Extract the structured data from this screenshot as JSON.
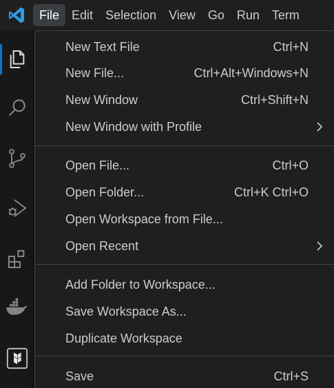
{
  "menubar": {
    "logo_icon": "vscode-logo-icon",
    "items": [
      {
        "label": "File",
        "active": true
      },
      {
        "label": "Edit"
      },
      {
        "label": "Selection"
      },
      {
        "label": "View"
      },
      {
        "label": "Go"
      },
      {
        "label": "Run"
      },
      {
        "label": "Term"
      }
    ]
  },
  "activitybar": {
    "icons": [
      "explorer-icon",
      "search-icon",
      "source-control-icon",
      "run-debug-icon",
      "extensions-icon",
      "docker-icon",
      "terraform-icon"
    ]
  },
  "file_menu": {
    "groups": [
      [
        {
          "label": "New Text File",
          "shortcut": "Ctrl+N"
        },
        {
          "label": "New File...",
          "shortcut": "Ctrl+Alt+Windows+N"
        },
        {
          "label": "New Window",
          "shortcut": "Ctrl+Shift+N"
        },
        {
          "label": "New Window with Profile",
          "submenu": true
        }
      ],
      [
        {
          "label": "Open File...",
          "shortcut": "Ctrl+O"
        },
        {
          "label": "Open Folder...",
          "shortcut": "Ctrl+K Ctrl+O"
        },
        {
          "label": "Open Workspace from File..."
        },
        {
          "label": "Open Recent",
          "submenu": true
        }
      ],
      [
        {
          "label": "Add Folder to Workspace..."
        },
        {
          "label": "Save Workspace As..."
        },
        {
          "label": "Duplicate Workspace"
        }
      ],
      [
        {
          "label": "Save",
          "shortcut": "Ctrl+S"
        }
      ]
    ]
  },
  "colors": {
    "accent": "#0078d4",
    "logo_blue": "#2f9be6",
    "menu_bg": "#1f1f1f",
    "text": "#cccccc"
  }
}
